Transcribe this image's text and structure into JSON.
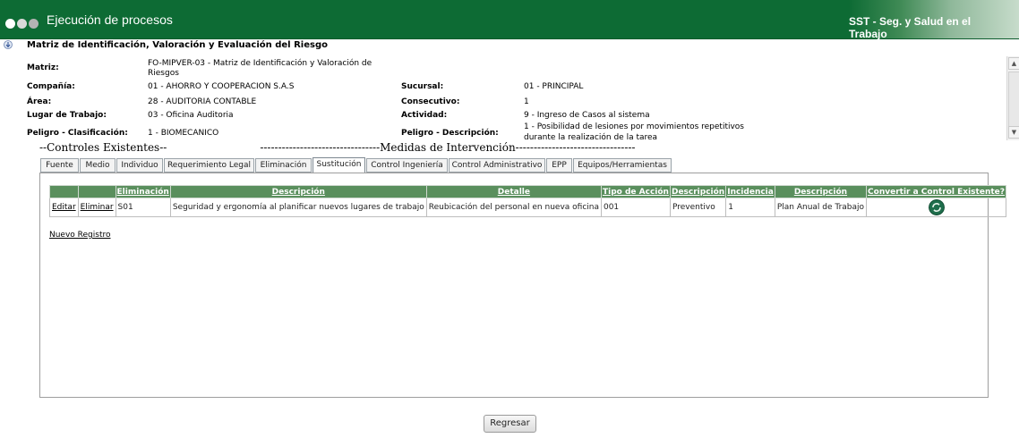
{
  "header": {
    "title": "Ejecución de procesos",
    "brand": "SST - Seg. y Salud en el Trabajo",
    "dot_colors": [
      "#ffffff",
      "#d9d9d9",
      "#b3b3b3"
    ]
  },
  "page_title": "Matriz de Identificación, Valoración y Evaluación del Riesgo",
  "form": {
    "matriz_label": "Matriz:",
    "matriz_value_line1": "FO-MIPVER-03 - Matriz de Identificación y Valoración de",
    "matriz_value_line2": "Riesgos",
    "compania_label": "Compañía:",
    "compania_value": "01 - AHORRO Y COOPERACION S.A.S",
    "sucursal_label": "Sucursal:",
    "sucursal_value": "01 - PRINCIPAL",
    "area_label": "Área:",
    "area_value": "28 - AUDITORIA CONTABLE",
    "consecutivo_label": "Consecutivo:",
    "consecutivo_value": "1",
    "lugar_label": "Lugar de Trabajo:",
    "lugar_value": "03 - Oficina Auditoria",
    "actividad_label": "Actividad:",
    "actividad_value": "9 - Ingreso de Casos al sistema",
    "peligro_clas_label": "Peligro - Clasificación:",
    "peligro_clas_value": "1 - BIOMECANICO",
    "peligro_desc_label": "Peligro - Descripción:",
    "peligro_desc_value_line1": "1 - Posibilidad de lesiones por movimientos repetitivos",
    "peligro_desc_value_line2": "durante la realización de la tarea"
  },
  "sections": {
    "controles": "--Controles Existentes--",
    "medidas": "---------------------------------Medidas de Intervención---------------------------------"
  },
  "tabs": [
    {
      "label": "Fuente"
    },
    {
      "label": "Medio"
    },
    {
      "label": "Individuo"
    },
    {
      "label": "Requerimiento Legal"
    },
    {
      "label": "Eliminación"
    },
    {
      "label": "Sustitución"
    },
    {
      "label": "Control Ingeniería"
    },
    {
      "label": "Control Administrativo"
    },
    {
      "label": "EPP"
    },
    {
      "label": "Equipos/Herramientas"
    }
  ],
  "active_tab": "Sustitución",
  "table": {
    "headers": [
      "",
      "",
      "Eliminación",
      "Descripción",
      "Detalle",
      "Tipo de Acción",
      "Descripción",
      "Incidencia",
      "Descripción",
      "Convertir a Control Existente?"
    ],
    "rows": [
      {
        "editar": "Editar",
        "eliminar": "Eliminar",
        "eliminacion": "S01",
        "descripcion": "Seguridad y ergonomía al planificar nuevos lugares de trabajo",
        "detalle": "Reubicación del personal en nueva oficina",
        "tipo_accion": "001",
        "descripcion_tipo": "Preventivo",
        "incidencia": "1",
        "descripcion_incidencia": "Plan Anual de Trabajo",
        "convert_icon": "convert-icon"
      }
    ]
  },
  "new_record": "Nuevo Registro",
  "back_button": "Regresar"
}
